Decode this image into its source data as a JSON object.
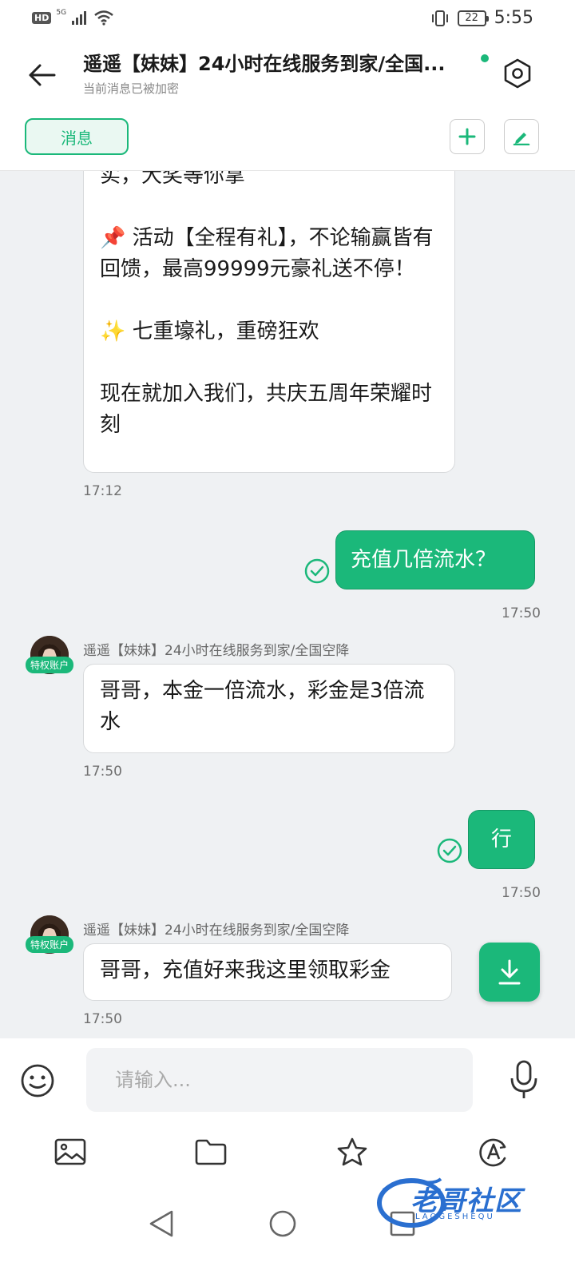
{
  "status_bar": {
    "hd": "HD",
    "network": "5G",
    "battery": "22",
    "time": "5:55"
  },
  "header": {
    "title": "遥遥【妹妹】24小时在线服务到家/全国...",
    "subtitle": "当前消息已被加密",
    "tab_label": "消息"
  },
  "messages": [
    {
      "kind": "in",
      "text": "实，大奖等你拿\n\n📌 活动【全程有礼】，不论输赢皆有回馈，最高99999元豪礼送不停！\n\n✨ 七重壕礼，重磅狂欢\n\n现在就加入我们，共庆五周年荣耀时刻",
      "time": "17:12"
    },
    {
      "kind": "out",
      "text": "充值几倍流水？",
      "time": "17:50"
    },
    {
      "kind": "in",
      "sender": "遥遥【妹妹】24小时在线服务到家/全国空降",
      "badge": "特权账户",
      "text": "哥哥，本金一倍流水，彩金是3倍流水",
      "time": "17:50"
    },
    {
      "kind": "out",
      "text": "行",
      "time": "17:50"
    },
    {
      "kind": "in",
      "sender": "遥遥【妹妹】24小时在线服务到家/全国空降",
      "badge": "特权账户",
      "text": "哥哥，充值好来我这里领取彩金",
      "time": "17:50"
    }
  ],
  "input": {
    "placeholder": "请输入..."
  },
  "watermark": {
    "text": "老哥社区",
    "sub": "LAOGESHEQU"
  },
  "colors": {
    "accent": "#1bb87a",
    "chat_bg": "#eff1f3"
  }
}
